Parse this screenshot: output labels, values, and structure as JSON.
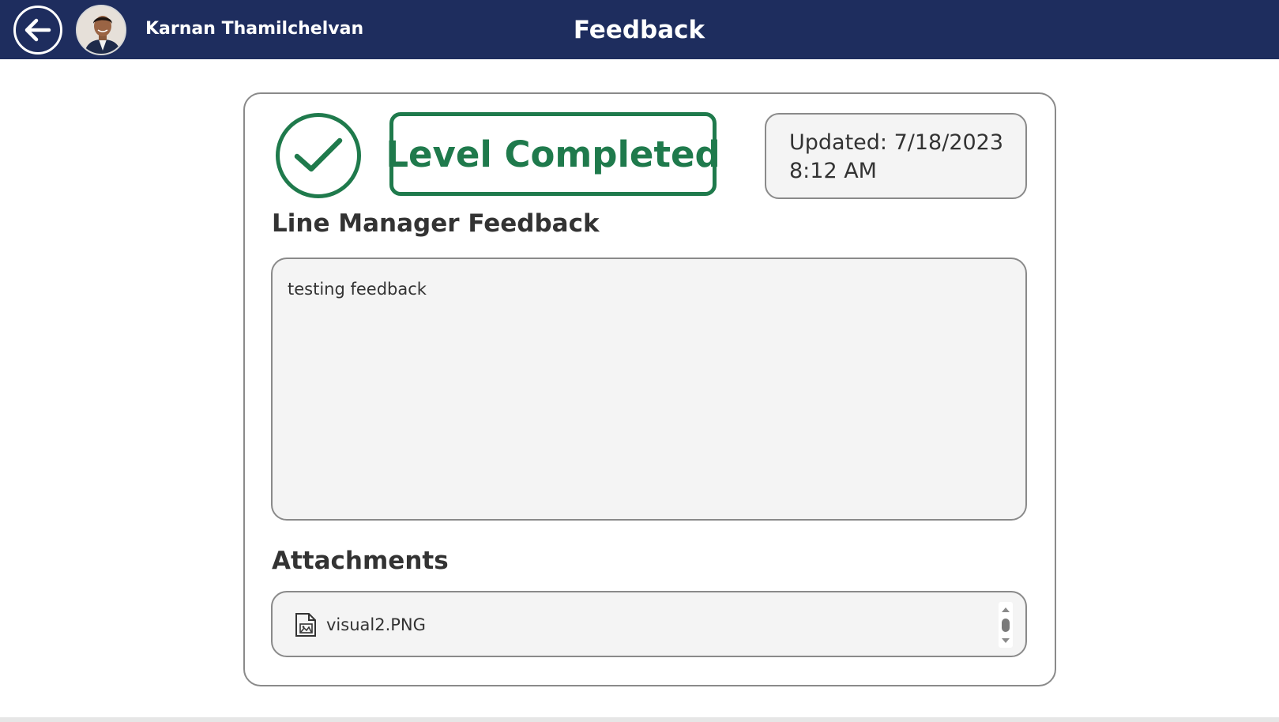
{
  "header": {
    "user_name": "Karnan Thamilchelvan",
    "title": "Feedback",
    "background_color": "#1e2d5e",
    "back_icon": "arrow-left-icon"
  },
  "status": {
    "badge_text": "Level Completed",
    "icon": "check-circle-icon",
    "color": "#1f7a4c"
  },
  "updated": {
    "line1": "Updated: 7/18/2023",
    "line2": "8:12 AM"
  },
  "feedback": {
    "label": "Line Manager Feedback",
    "text": "testing feedback"
  },
  "attachments": {
    "label": "Attachments",
    "items": [
      {
        "name": "visual2.PNG",
        "icon": "image-file-icon"
      }
    ]
  }
}
